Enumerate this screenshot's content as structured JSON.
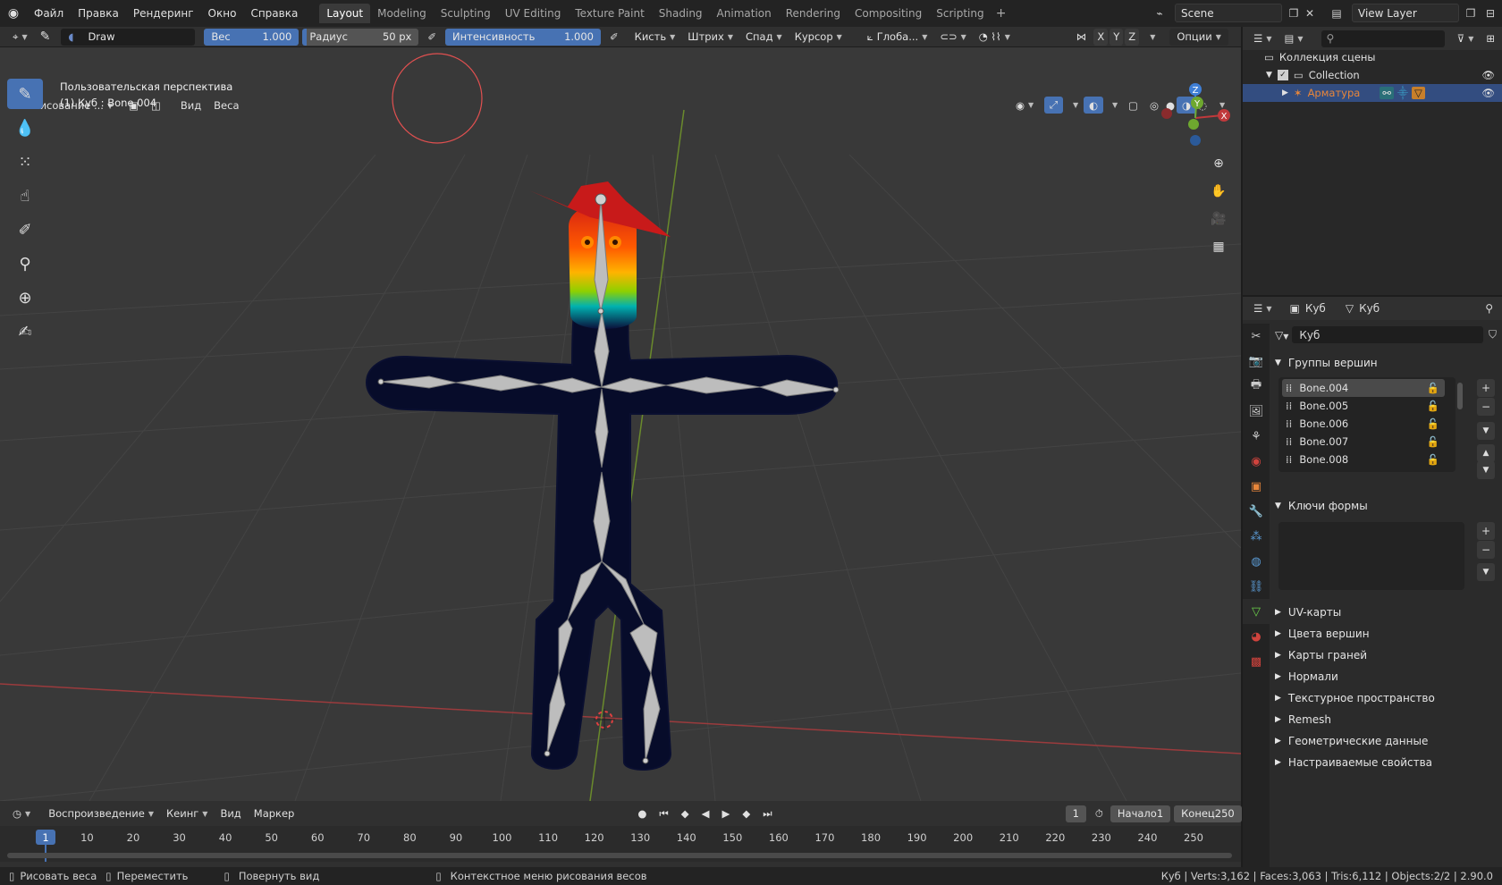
{
  "app": {
    "menus": [
      "Файл",
      "Правка",
      "Рендеринг",
      "Окно",
      "Справка"
    ],
    "workspace_tabs": [
      "Layout",
      "Modeling",
      "Sculpting",
      "UV Editing",
      "Texture Paint",
      "Shading",
      "Animation",
      "Rendering",
      "Compositing",
      "Scripting"
    ],
    "active_tab": "Layout",
    "scene_name": "Scene",
    "view_layer": "View Layer"
  },
  "tool_header": {
    "brush_name": "Draw",
    "weight_label": "Вес",
    "weight_value": "1.000",
    "radius_label": "Радиус",
    "radius_value": "50 px",
    "strength_label": "Интенсивность",
    "strength_value": "1.000",
    "dropdowns": [
      "Кисть",
      "Штрих",
      "Спад",
      "Курсор"
    ],
    "orientation": "Глоба...",
    "axes": [
      "X",
      "Y",
      "Z"
    ],
    "options": "Опции"
  },
  "viewport_header": {
    "mode": "Рисование ...",
    "view": "Вид",
    "weights": "Веса"
  },
  "viewport": {
    "perspective": "Пользовательская перспектива",
    "object_info": "(1) Куб : Bone.004",
    "gizmo": {
      "z": "Z",
      "y": "Y",
      "x": "X"
    }
  },
  "timeline": {
    "playback": "Воспроизведение",
    "keying": "Кеинг",
    "view": "Вид",
    "marker": "Маркер",
    "current_frame": "1",
    "start_label": "Начало",
    "start_value": "1",
    "end_label": "Конец",
    "end_value": "250",
    "ruler": [
      "1",
      "10",
      "20",
      "30",
      "40",
      "50",
      "60",
      "70",
      "80",
      "90",
      "100",
      "110",
      "120",
      "130",
      "140",
      "150",
      "160",
      "170",
      "180",
      "190",
      "200",
      "210",
      "220",
      "230",
      "240",
      "250"
    ]
  },
  "statusbar": {
    "left_action": "Рисовать веса",
    "middle_action": "Переместить",
    "right_action": "Повернуть вид",
    "context": "Контекстное меню рисования весов",
    "stats": "Куб | Verts:3,162 | Faces:3,063 | Tris:6,112 | Objects:2/2 | 2.90.0"
  },
  "outliner": {
    "scene_collection": "Коллекция сцены",
    "collection": "Collection",
    "armature": "Арматура"
  },
  "properties": {
    "breadcrumb_object": "Куб",
    "breadcrumb_data": "Куб",
    "mesh_name": "Куб",
    "vertex_groups_title": "Группы вершин",
    "vertex_groups": [
      "Bone.004",
      "Bone.005",
      "Bone.006",
      "Bone.007",
      "Bone.008"
    ],
    "shape_keys_title": "Ключи формы",
    "panels": [
      "UV-карты",
      "Цвета вершин",
      "Карты граней",
      "Нормали",
      "Текстурное пространство",
      "Remesh",
      "Геометрические данные",
      "Настраиваемые свойства"
    ]
  },
  "colors": {
    "accent": "#4772b3",
    "armature_text": "#e8863a",
    "x_axis": "#c0393b",
    "y_axis": "#6ea82f",
    "z_axis": "#3f7fd6"
  }
}
